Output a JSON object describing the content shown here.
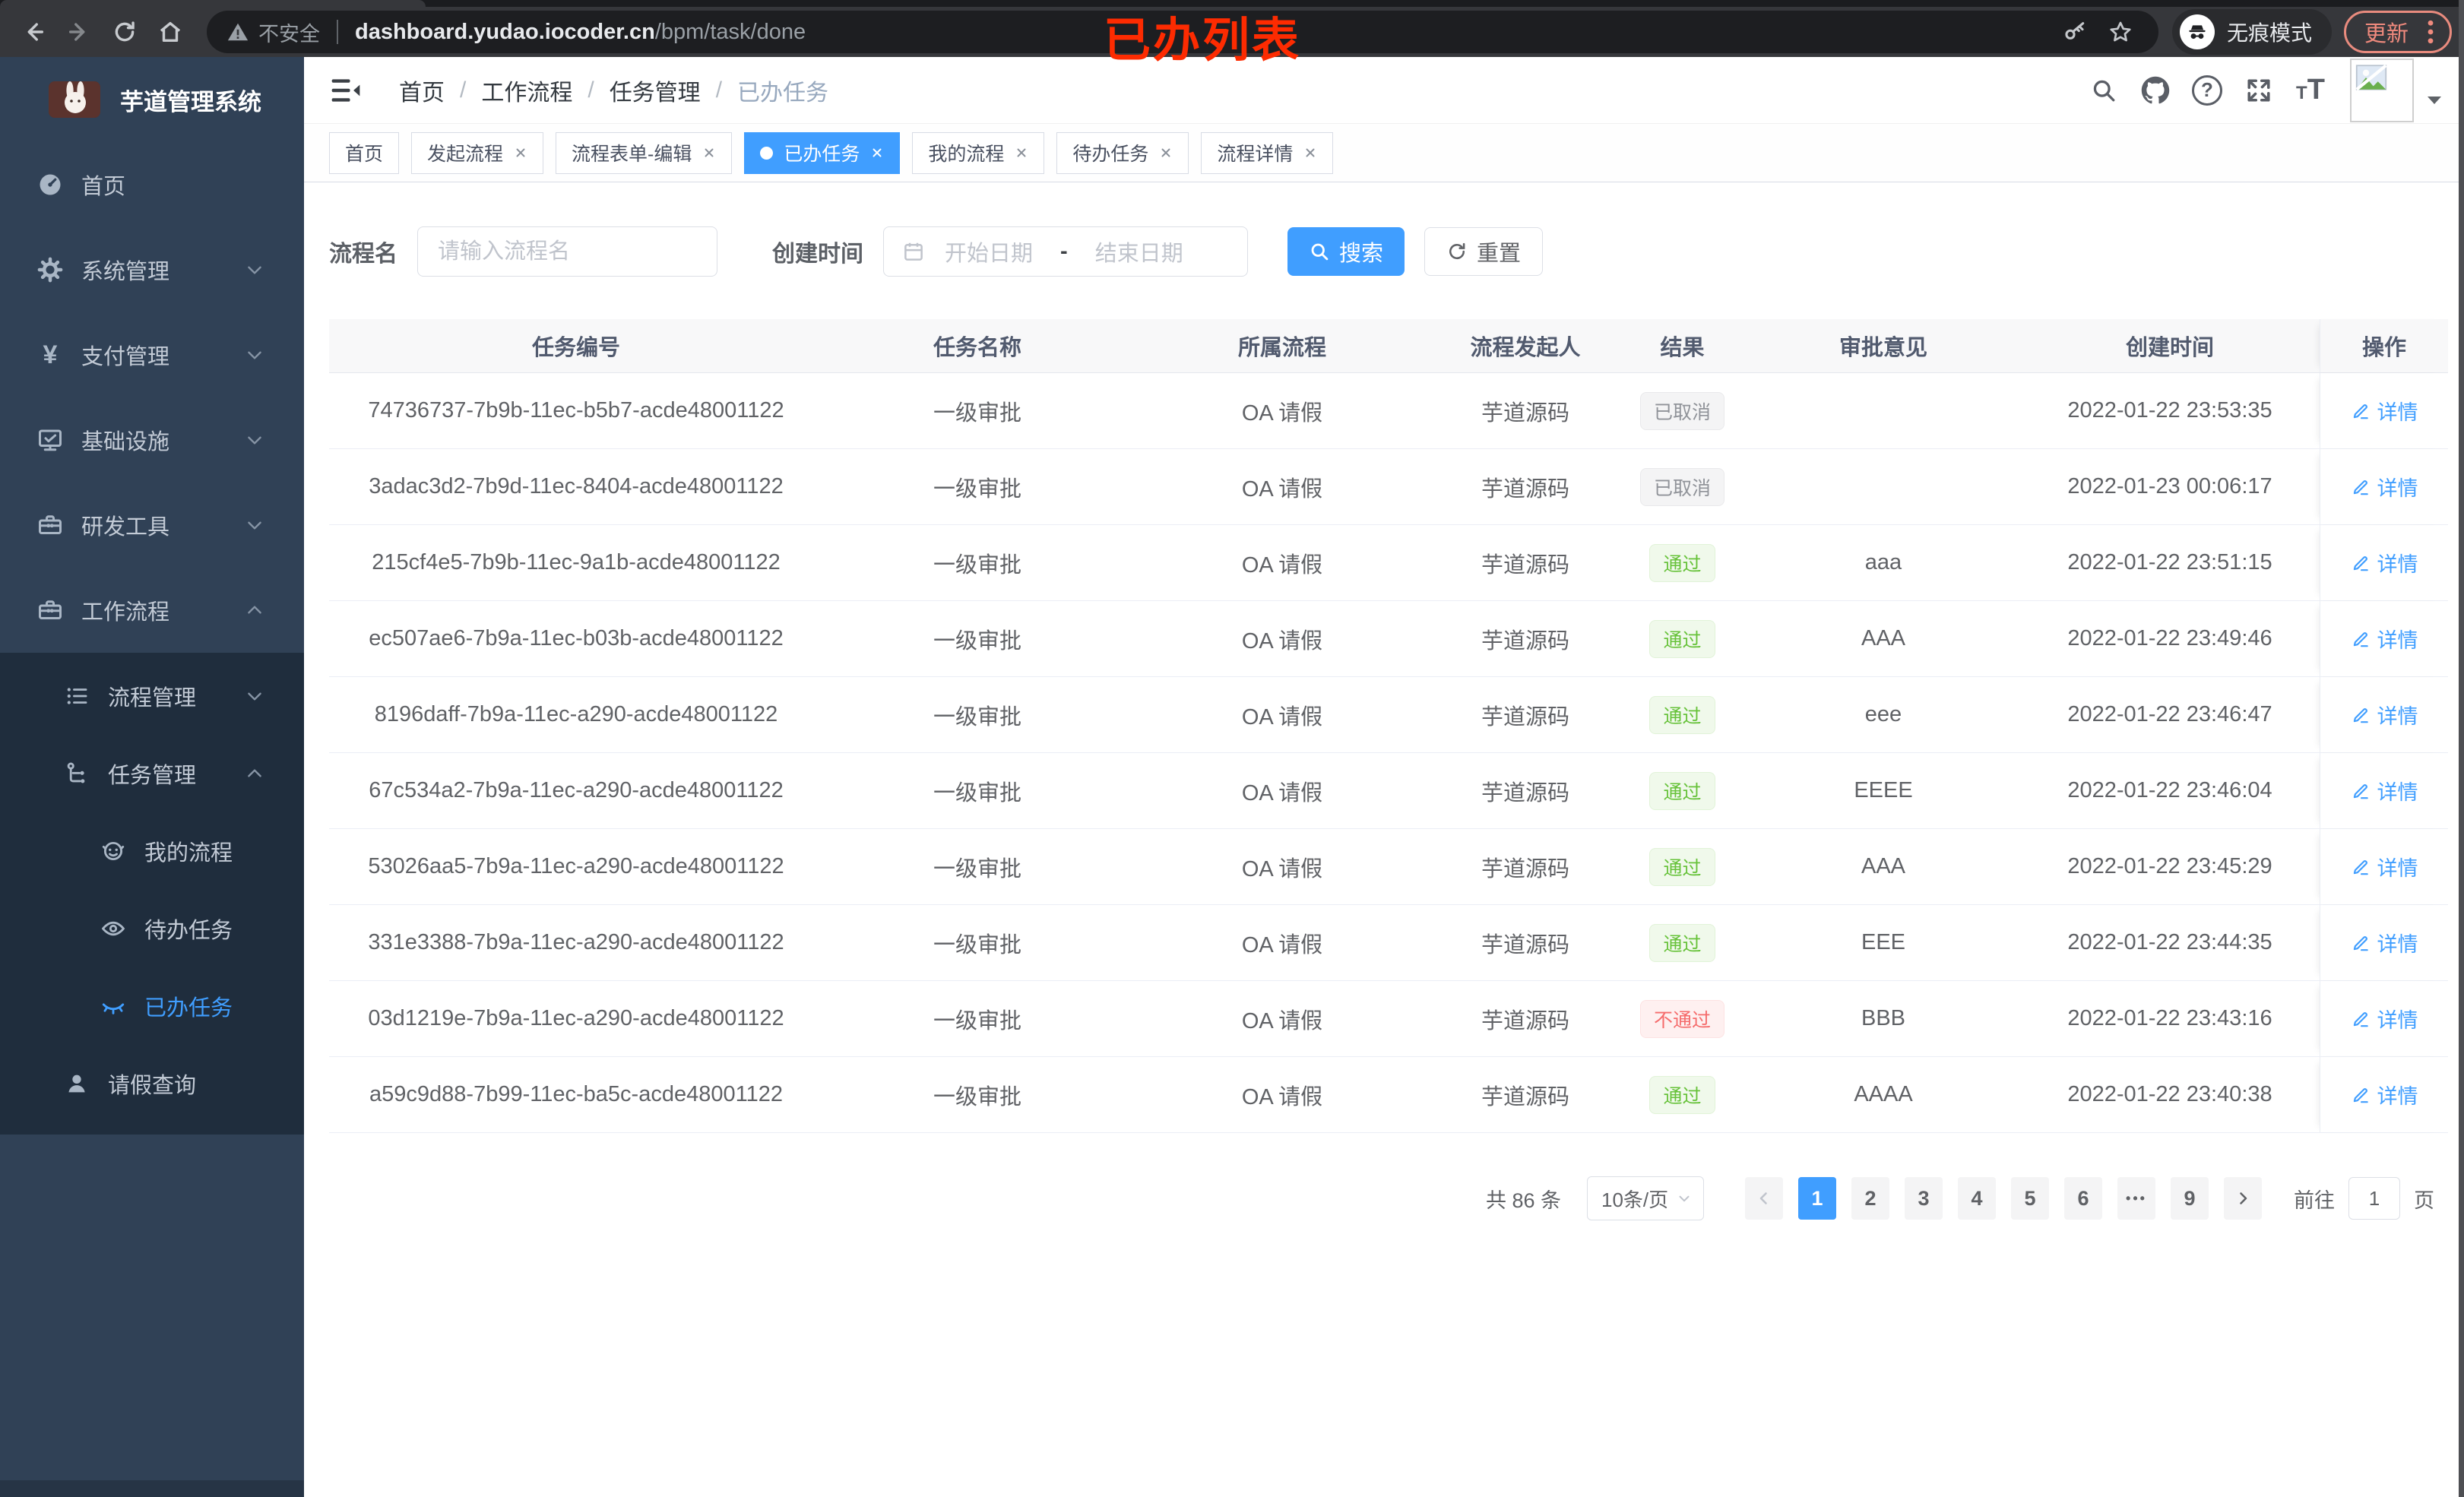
{
  "browser": {
    "security_label": "不安全",
    "url_host": "dashboard.yudao.iocoder.cn",
    "url_path": "/bpm/task/done",
    "incognito_label": "无痕模式",
    "update_label": "更新"
  },
  "annotation": {
    "text": "已办列表",
    "color": "#fd2b01"
  },
  "sidebar": {
    "title": "芋道管理系统",
    "items": [
      {
        "label": "首页"
      },
      {
        "label": "系统管理"
      },
      {
        "label": "支付管理"
      },
      {
        "label": "基础设施"
      },
      {
        "label": "研发工具"
      },
      {
        "label": "工作流程"
      },
      {
        "label": "流程管理"
      },
      {
        "label": "任务管理"
      },
      {
        "label": "我的流程"
      },
      {
        "label": "待办任务"
      },
      {
        "label": "已办任务",
        "active": true
      },
      {
        "label": "请假查询"
      }
    ]
  },
  "navbar": {
    "breadcrumb": [
      "首页",
      "工作流程",
      "任务管理",
      "已办任务"
    ]
  },
  "tabs": [
    {
      "label": "首页",
      "closable": false
    },
    {
      "label": "发起流程",
      "closable": true
    },
    {
      "label": "流程表单-编辑",
      "closable": true
    },
    {
      "label": "已办任务",
      "closable": true,
      "active": true,
      "cls": "active"
    },
    {
      "label": "我的流程",
      "closable": true
    },
    {
      "label": "待办任务",
      "closable": true
    },
    {
      "label": "流程详情",
      "closable": true
    }
  ],
  "filters": {
    "name_label": "流程名",
    "name_placeholder": "请输入流程名",
    "time_label": "创建时间",
    "start_placeholder": "开始日期",
    "range_separator": "-",
    "end_placeholder": "结束日期",
    "search_label": "搜索",
    "reset_label": "重置"
  },
  "table": {
    "columns": [
      "任务编号",
      "任务名称",
      "所属流程",
      "流程发起人",
      "结果",
      "审批意见",
      "创建时间",
      "操作"
    ],
    "detail_label": "详情",
    "rows": [
      {
        "id": "74736737-7b9b-11ec-b5b7-acde48001122",
        "name": "一级审批",
        "process": "OA 请假",
        "starter": "芋道源码",
        "result": "已取消",
        "result_type": "info",
        "opinion": "",
        "created": "2022-01-22 23:53:35"
      },
      {
        "id": "3adac3d2-7b9d-11ec-8404-acde48001122",
        "name": "一级审批",
        "process": "OA 请假",
        "starter": "芋道源码",
        "result": "已取消",
        "result_type": "info",
        "opinion": "",
        "created": "2022-01-23 00:06:17"
      },
      {
        "id": "215cf4e5-7b9b-11ec-9a1b-acde48001122",
        "name": "一级审批",
        "process": "OA 请假",
        "starter": "芋道源码",
        "result": "通过",
        "result_type": "success",
        "opinion": "aaa",
        "created": "2022-01-22 23:51:15"
      },
      {
        "id": "ec507ae6-7b9a-11ec-b03b-acde48001122",
        "name": "一级审批",
        "process": "OA 请假",
        "starter": "芋道源码",
        "result": "通过",
        "result_type": "success",
        "opinion": "AAA",
        "created": "2022-01-22 23:49:46"
      },
      {
        "id": "8196daff-7b9a-11ec-a290-acde48001122",
        "name": "一级审批",
        "process": "OA 请假",
        "starter": "芋道源码",
        "result": "通过",
        "result_type": "success",
        "opinion": "eee",
        "created": "2022-01-22 23:46:47"
      },
      {
        "id": "67c534a2-7b9a-11ec-a290-acde48001122",
        "name": "一级审批",
        "process": "OA 请假",
        "starter": "芋道源码",
        "result": "通过",
        "result_type": "success",
        "opinion": "EEEE",
        "created": "2022-01-22 23:46:04"
      },
      {
        "id": "53026aa5-7b9a-11ec-a290-acde48001122",
        "name": "一级审批",
        "process": "OA 请假",
        "starter": "芋道源码",
        "result": "通过",
        "result_type": "success",
        "opinion": "AAA",
        "created": "2022-01-22 23:45:29"
      },
      {
        "id": "331e3388-7b9a-11ec-a290-acde48001122",
        "name": "一级审批",
        "process": "OA 请假",
        "starter": "芋道源码",
        "result": "通过",
        "result_type": "success",
        "opinion": "EEE",
        "created": "2022-01-22 23:44:35"
      },
      {
        "id": "03d1219e-7b9a-11ec-a290-acde48001122",
        "name": "一级审批",
        "process": "OA 请假",
        "starter": "芋道源码",
        "result": "不通过",
        "result_type": "danger",
        "opinion": "BBB",
        "created": "2022-01-22 23:43:16"
      },
      {
        "id": "a59c9d88-7b99-11ec-ba5c-acde48001122",
        "name": "一级审批",
        "process": "OA 请假",
        "starter": "芋道源码",
        "result": "通过",
        "result_type": "success",
        "opinion": "AAAA",
        "created": "2022-01-22 23:40:38"
      }
    ]
  },
  "pagination": {
    "total_label": "共 86 条",
    "page_size": "10条/页",
    "pages": [
      {
        "label": "1",
        "cls": "active"
      },
      {
        "label": "2"
      },
      {
        "label": "3"
      },
      {
        "label": "4"
      },
      {
        "label": "5"
      },
      {
        "label": "6"
      },
      {
        "label": "•••",
        "cls": "more"
      },
      {
        "label": "9"
      }
    ],
    "goto_label": "前往",
    "goto_value": "1",
    "page_unit": "页"
  },
  "colors": {
    "accent": "#409eff",
    "success": "#67c23a",
    "danger": "#f56c6c",
    "info": "#909399",
    "sidebar_bg": "#304156",
    "submenu_bg": "#1f2d3d",
    "chrome_bg": "#36373b",
    "annotation_red": "#fd2b01"
  },
  "icons": {
    "back-icon": "‹",
    "forward-icon": "›",
    "reload-icon": "⟳",
    "home-icon": "⌂",
    "not-secure-icon": "⚠",
    "key-icon": "⚿",
    "star-icon": "☆",
    "incognito-icon": "🕶",
    "menu-dots-icon": "⋮",
    "search-icon": "⌕",
    "github-icon": "",
    "help-icon": "?",
    "fullscreen-icon": "⛶",
    "font-size-icon": "tT",
    "caret-down-icon": "▾",
    "hamburger-icon": "☰",
    "dashboard-icon": "◔",
    "gear-icon": "⚙",
    "yen-icon": "¥",
    "monitor-icon": "🖵",
    "toolbox-icon": "🧰",
    "list-icon": "≡",
    "tree-icon": "⑂",
    "robot-icon": "☺",
    "eye-icon": "◉",
    "eye-closed-icon": "◡",
    "user-icon": "👤",
    "calendar-icon": "▦",
    "refresh-icon": "⟳",
    "edit-icon": "✎",
    "close-icon": "×"
  }
}
